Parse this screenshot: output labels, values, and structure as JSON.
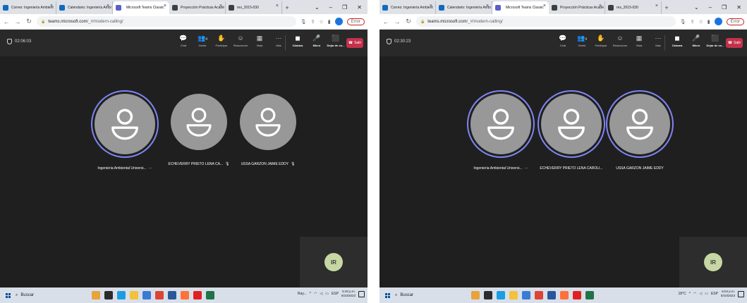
{
  "screenshots": [
    {
      "id": "left",
      "tabs": [
        {
          "label": "Correo: Ingeniería Ambient",
          "favicon": "outlook-icon",
          "color": "#0f6cbd",
          "active": false
        },
        {
          "label": "Calendario: Ingeniería Ambi",
          "favicon": "calendar-icon",
          "color": "#0f6cbd",
          "active": false
        },
        {
          "label": "Microsoft Teams Classic",
          "favicon": "teams-icon",
          "color": "#5b5fc7",
          "active": true,
          "recording": true
        },
        {
          "label": "Proyección Prácticas Acadé",
          "favicon": "chrome-icon",
          "color": "#3c4043",
          "active": false
        },
        {
          "label": "res_2015-030",
          "favicon": "chrome-icon",
          "color": "#3c4043",
          "active": false
        }
      ],
      "url": {
        "host": "teams.microsoft.com",
        "path": "/_#/modern-calling/"
      },
      "profile_chip": "Error",
      "timer": "02:06:03",
      "controls": [
        "Chat",
        "Gente",
        "Participar",
        "Reaccionar",
        "Vista",
        "Más"
      ],
      "people_count": "4",
      "device_controls": [
        "Cámara",
        "Micro",
        "Dejar de co..."
      ],
      "leave_label": "Salir",
      "participants": [
        {
          "name": "Ingeniería Ambiental Universi...",
          "suffix": "···",
          "speaking": true
        },
        {
          "name": "ECHEVERRY PRIETO LENA CA...",
          "suffix": "🎙",
          "speaking": false
        },
        {
          "name": "USSA GARZON JAIME EDDY",
          "suffix": "🎙",
          "speaking": false
        }
      ],
      "self_initials": "IR",
      "taskbar": {
        "search": "Buscar",
        "tray_label": "Ray...",
        "lang": "ESP",
        "time": "5:40 p.m.",
        "date": "8/10/2023",
        "weather": ""
      }
    },
    {
      "id": "right",
      "tabs": [
        {
          "label": "Correo: Ingeniería Ambient",
          "favicon": "outlook-icon",
          "color": "#0f6cbd",
          "active": false
        },
        {
          "label": "Calendario: Ingeniería Ambi",
          "favicon": "calendar-icon",
          "color": "#0f6cbd",
          "active": false
        },
        {
          "label": "Microsoft Teams Classic",
          "favicon": "teams-icon",
          "color": "#5b5fc7",
          "active": true,
          "recording": true
        },
        {
          "label": "Proyección Prácticas Acadé",
          "favicon": "chrome-icon",
          "color": "#3c4043",
          "active": false
        },
        {
          "label": "res_2015-030",
          "favicon": "chrome-icon",
          "color": "#3c4043",
          "active": false
        }
      ],
      "url": {
        "host": "teams.microsoft.com",
        "path": "/_#/modern-calling/"
      },
      "profile_chip": "Error",
      "timer": "02:30:23",
      "controls": [
        "Chat",
        "Gente",
        "Participar",
        "Reaccionar",
        "Vista",
        "Más"
      ],
      "people_count": "4",
      "device_controls": [
        "Cámara",
        "Micro",
        "Dejar de co..."
      ],
      "leave_label": "Salir",
      "participants": [
        {
          "name": "Ingeniería Ambiental Universi...",
          "suffix": "···",
          "speaking": true
        },
        {
          "name": "ECHEVERRY PRIETO LENA CAROLI...",
          "suffix": "",
          "speaking": true
        },
        {
          "name": "USSA GARZON JAIME EDDY",
          "suffix": "",
          "speaking": true
        }
      ],
      "self_initials": "IR",
      "taskbar": {
        "search": "Buscar",
        "tray_label": "",
        "lang": "ESP",
        "time": "6:04 p.m.",
        "date": "8/10/2023",
        "weather": "18°C"
      }
    }
  ],
  "colors": {
    "leave": "#c4314b",
    "speaking_ring": "#7f85f5",
    "avatar": "#989898",
    "self_avatar": "#c6d7a4"
  }
}
